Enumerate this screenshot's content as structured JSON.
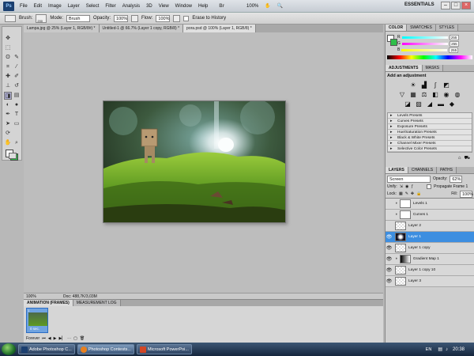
{
  "menubar": {
    "logo": "Ps",
    "items": [
      "File",
      "Edit",
      "Image",
      "Layer",
      "Select",
      "Filter",
      "Analysis",
      "3D",
      "View",
      "Window",
      "Help"
    ],
    "zoom": "100%",
    "workspace": "ESSENTIALS",
    "win_min": "–",
    "win_max": "□",
    "win_close": "×"
  },
  "options": {
    "brush_label": "Brush:",
    "brush_size": "200",
    "mode_label": "Mode:",
    "mode_value": "Brush",
    "opacity_label": "Opacity:",
    "opacity_value": "100%",
    "flow_label": "Flow:",
    "flow_value": "100%",
    "erase_history": "Erase to History"
  },
  "doc_tabs": [
    "Lampa.jpg @ 25% (Layer 1, RGB/8#) *",
    "Untitled-1 @ 66.7% (Layer 1 copy, RGB/8) *",
    "pora.psd @ 100% (Layer 1, RGB/8) *"
  ],
  "status": {
    "zoom": "100%",
    "doc": "Doc: 488,7K/3,03M"
  },
  "animation": {
    "tabs": [
      "ANIMATION (FRAMES)",
      "MEASUREMENT LOG"
    ],
    "frame_label": "0 sec.",
    "frame_number": "1",
    "loop": "Forever"
  },
  "color_panel": {
    "tabs": [
      "COLOR",
      "SWATCHES",
      "STYLES"
    ],
    "r_label": "R",
    "g_label": "G",
    "b_label": "B",
    "r": "255",
    "g": "255",
    "b": "255"
  },
  "adjustments": {
    "tabs": [
      "ADJUSTMENTS",
      "MASKS"
    ],
    "title": "Add an adjustment",
    "presets": [
      "Levels Presets",
      "Curves Presets",
      "Exposure Presets",
      "Hue/Saturation Presets",
      "Black & White Presets",
      "Channel Mixer Presets",
      "Selective Color Presets"
    ]
  },
  "layers": {
    "tabs": [
      "LAYERS",
      "CHANNELS",
      "PATHS"
    ],
    "blend": "Screen",
    "opacity_label": "Opacity:",
    "opacity": "62%",
    "unify_label": "Unify:",
    "propagate": "Propagate Frame 1",
    "lock_label": "Lock:",
    "fill_label": "Fill:",
    "fill": "100%",
    "items": [
      "Levels 1",
      "Curves 1",
      "Layer 2",
      "Layer 1",
      "Layer 1 copy",
      "Gradient Map 1",
      "Layer 1 copy 10",
      "Layer 3"
    ],
    "visible": [
      false,
      false,
      false,
      true,
      true,
      true,
      true,
      true
    ],
    "selected_index": 3
  },
  "taskbar": {
    "items": [
      "Adobe Photoshop C...",
      "Photoshop Contests...",
      "Microsoft PowerPoi..."
    ],
    "lang": "EN",
    "time": "20:38"
  },
  "colors": {
    "accent": "#3d8ee0",
    "fg": "#ffffff",
    "bg": "#2fbf4a"
  }
}
